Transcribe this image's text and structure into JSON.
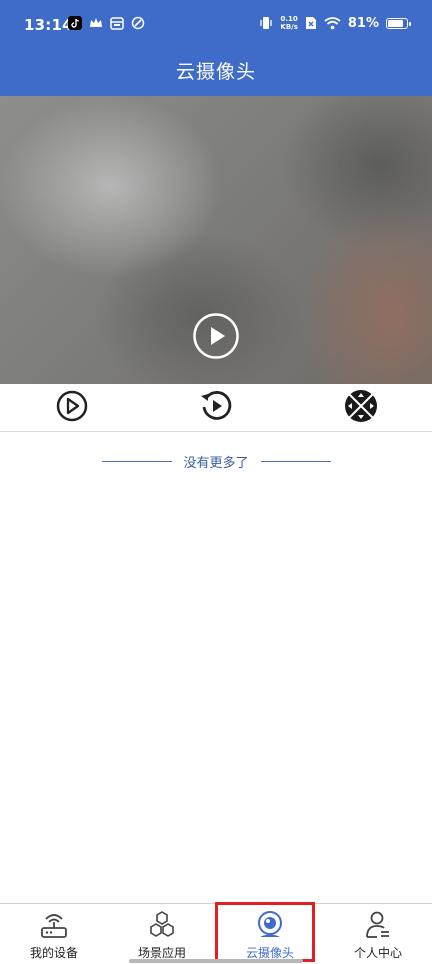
{
  "status_bar": {
    "time": "13:14",
    "speed_value": "0.10",
    "speed_unit": "KB/s",
    "battery": "81%",
    "icons": [
      "tiktok-icon",
      "crown-icon",
      "calendar-icon",
      "link-icon",
      "vibrate-icon",
      "sim-x-icon",
      "wifi-icon",
      "battery-icon"
    ]
  },
  "header": {
    "title": "云摄像头"
  },
  "player": {
    "play_icon": "play-circle-icon",
    "controls": [
      {
        "name": "play-button",
        "icon": "play-circle-icon"
      },
      {
        "name": "replay-button",
        "icon": "replay-icon"
      },
      {
        "name": "ptz-direction-button",
        "icon": "direction-pad-icon"
      }
    ]
  },
  "list": {
    "end_text": "没有更多了"
  },
  "tabbar": {
    "tabs": [
      {
        "label": "我的设备",
        "icon": "router-icon",
        "active": false
      },
      {
        "label": "场景应用",
        "icon": "hexagons-icon",
        "active": false
      },
      {
        "label": "云摄像头",
        "icon": "camera-icon",
        "active": true
      },
      {
        "label": "个人中心",
        "icon": "user-icon",
        "active": false
      }
    ]
  },
  "colors": {
    "header_bg": "#3f6bc9",
    "accent": "#3f6bc9",
    "highlight": "#e02020",
    "text_link": "#3a5d9e"
  }
}
